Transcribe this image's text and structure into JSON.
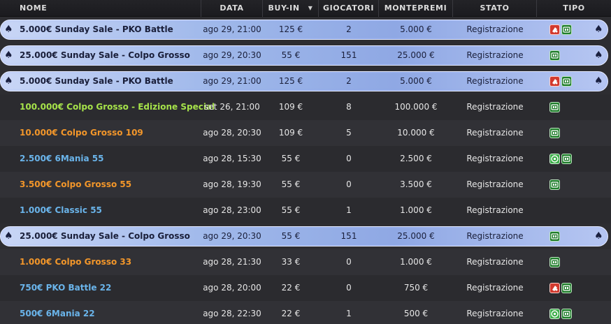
{
  "columns": {
    "nome": "NOME",
    "data": "DATA",
    "buyin": "BUY-IN",
    "giocatori": "GIOCATORI",
    "montepremi": "MONTEPREMI",
    "stato": "STATO",
    "tipo": "TIPO"
  },
  "colors": {
    "green_name": "#a6e34a",
    "orange_name": "#f2962a",
    "blue_name": "#6ab4ea"
  },
  "rows": [
    {
      "name": "5.000€ Sunday Sale - PKO Battle",
      "date": "ago 29, 21:00",
      "buyin": "125 €",
      "players": "2",
      "prize": "5.000 €",
      "status": "Registrazione",
      "featured": true,
      "color": "",
      "badges": [
        "red",
        "green"
      ]
    },
    {
      "name": "25.000€ Sunday Sale - Colpo Grosso",
      "date": "ago 29, 20:30",
      "buyin": "55 €",
      "players": "151",
      "prize": "25.000 €",
      "status": "Registrazione",
      "featured": true,
      "color": "",
      "badges": [
        "green"
      ]
    },
    {
      "name": "5.000€ Sunday Sale - PKO Battle",
      "date": "ago 29, 21:00",
      "buyin": "125 €",
      "players": "2",
      "prize": "5.000 €",
      "status": "Registrazione",
      "featured": true,
      "color": "",
      "badges": [
        "red",
        "green"
      ]
    },
    {
      "name": "100.000€ Colpo Grosso - Edizione Special",
      "date": "set 26, 21:00",
      "buyin": "109 €",
      "players": "8",
      "prize": "100.000 €",
      "status": "Registrazione",
      "featured": false,
      "color": "green_name",
      "badges": [
        "green"
      ]
    },
    {
      "name": "10.000€ Colpo Grosso 109",
      "date": "ago 28, 20:30",
      "buyin": "109 €",
      "players": "5",
      "prize": "10.000 €",
      "status": "Registrazione",
      "featured": false,
      "color": "orange_name",
      "badges": [
        "green"
      ]
    },
    {
      "name": "2.500€ 6Mania 55",
      "date": "ago 28, 15:30",
      "buyin": "55 €",
      "players": "0",
      "prize": "2.500 €",
      "status": "Registrazione",
      "featured": false,
      "color": "blue_name",
      "badges": [
        "mania",
        "green"
      ]
    },
    {
      "name": "3.500€ Colpo Grosso 55",
      "date": "ago 28, 19:30",
      "buyin": "55 €",
      "players": "0",
      "prize": "3.500 €",
      "status": "Registrazione",
      "featured": false,
      "color": "orange_name",
      "badges": [
        "green"
      ]
    },
    {
      "name": "1.000€ Classic 55",
      "date": "ago 28, 23:00",
      "buyin": "55 €",
      "players": "1",
      "prize": "1.000 €",
      "status": "Registrazione",
      "featured": false,
      "color": "blue_name",
      "badges": []
    },
    {
      "name": "25.000€ Sunday Sale - Colpo Grosso",
      "date": "ago 29, 20:30",
      "buyin": "55 €",
      "players": "151",
      "prize": "25.000 €",
      "status": "Registrazione",
      "featured": true,
      "color": "",
      "badges": [
        "green"
      ]
    },
    {
      "name": "1.000€ Colpo Grosso 33",
      "date": "ago 28, 21:30",
      "buyin": "33 €",
      "players": "0",
      "prize": "1.000 €",
      "status": "Registrazione",
      "featured": false,
      "color": "orange_name",
      "badges": [
        "green"
      ]
    },
    {
      "name": "750€ PKO Battle 22",
      "date": "ago 28, 20:00",
      "buyin": "22 €",
      "players": "0",
      "prize": "750 €",
      "status": "Registrazione",
      "featured": false,
      "color": "blue_name",
      "badges": [
        "red",
        "green"
      ]
    },
    {
      "name": "500€ 6Mania 22",
      "date": "ago 28, 22:30",
      "buyin": "22 €",
      "players": "1",
      "prize": "500 €",
      "status": "Registrazione",
      "featured": false,
      "color": "blue_name",
      "badges": [
        "mania",
        "green"
      ]
    }
  ]
}
